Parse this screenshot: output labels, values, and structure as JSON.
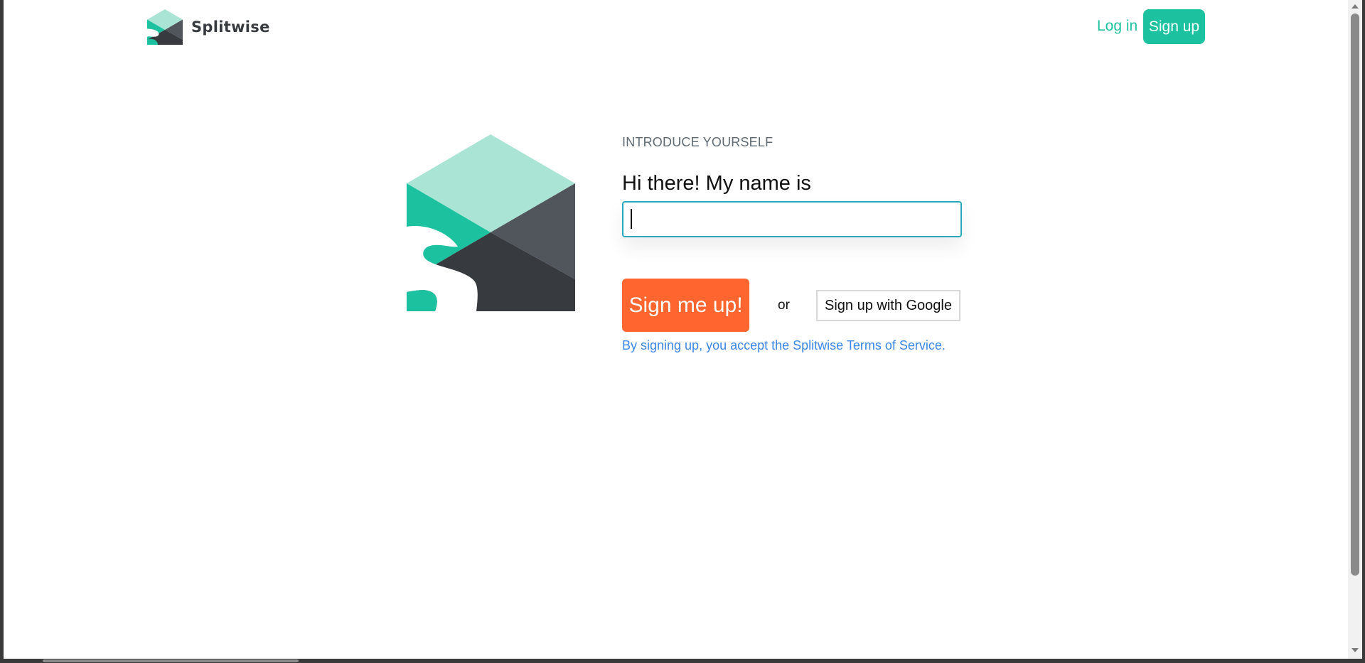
{
  "header": {
    "brand_name": "Splitwise",
    "login_label": "Log in",
    "signup_label": "Sign up"
  },
  "form": {
    "eyebrow": "INTRODUCE YOURSELF",
    "greeting": "Hi there! My name is",
    "name_value": "",
    "submit_label": "Sign me up!",
    "or_label": "or",
    "google_label": "Sign up with Google",
    "terms_text": "By signing up, you accept the Splitwise Terms of Service."
  },
  "colors": {
    "brand_teal": "#1cc29f",
    "brand_light_teal": "#aae4d4",
    "brand_dark": "#373b3f",
    "brand_gray": "#50565c",
    "cta_orange": "#ff652f",
    "link_blue": "#3a86e4",
    "input_focus": "#2aa7bd"
  },
  "icons": {
    "brand_logo": "splitwise-logo-icon",
    "hero_logo": "splitwise-logo-icon"
  }
}
